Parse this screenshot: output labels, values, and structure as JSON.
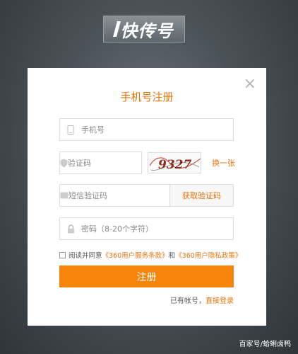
{
  "logo": {
    "text": "快传号"
  },
  "form": {
    "title": "手机号注册",
    "close": "×",
    "phone_placeholder": "手机号",
    "captcha_placeholder": "验证码",
    "captcha_text": "9327",
    "refresh_label": "换一张",
    "sms_placeholder": "短信验证码",
    "sms_button": "获取验证码",
    "password_placeholder": "密码（8-20个字符）",
    "agree_prefix": "阅读并同意",
    "terms_link": "《360用户服务条款》",
    "agree_and": "和",
    "privacy_link": "《360用户隐私政策》",
    "submit_label": "注册",
    "has_account": "已有帐号，",
    "login_link": "直接登录"
  },
  "watermark": "百家号/蛤蜊卤鸭",
  "colors": {
    "accent": "#f7850c",
    "link": "#e8730a"
  }
}
